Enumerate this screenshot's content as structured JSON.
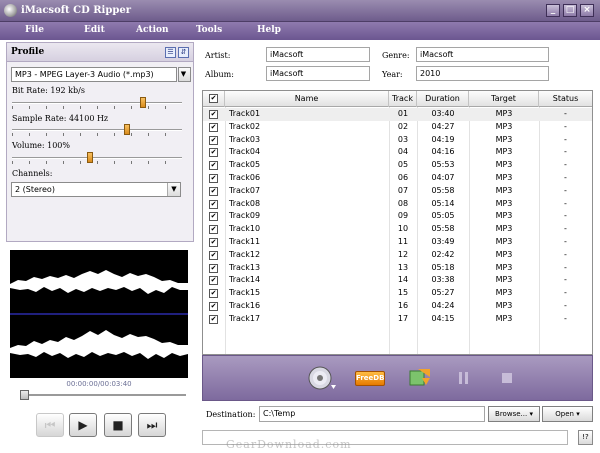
{
  "window": {
    "title": "iMacsoft CD Ripper",
    "minimize": "_",
    "maximize": "□",
    "close": "×"
  },
  "menu": [
    "File",
    "Edit",
    "Action",
    "Tools",
    "Help"
  ],
  "profile": {
    "title": "Profile",
    "format": "MP3 - MPEG Layer-3 Audio (*.mp3)",
    "bitrate_label": "Bit Rate: 192 kb/s",
    "samplerate_label": "Sample Rate: 44100 Hz",
    "volume_label": "Volume: 100%",
    "channels_label": "Channels:",
    "channels_value": "2 (Stereo)",
    "bitrate_level": 0.78,
    "samplerate_level": 0.68,
    "volume_level": 0.46
  },
  "player": {
    "time": "00:00:00/00:03:40",
    "seek_position": 0.0
  },
  "info": {
    "artist_label": "Artist:",
    "artist": "iMacsoft",
    "album_label": "Album:",
    "album": "iMacsoft",
    "genre_label": "Genre:",
    "genre": "iMacsoft",
    "year_label": "Year:",
    "year": "2010"
  },
  "columns": {
    "name": "Name",
    "track": "Track",
    "duration": "Duration",
    "target": "Target",
    "status": "Status"
  },
  "tracks": [
    {
      "name": "Track01",
      "track": "01",
      "duration": "03:40",
      "target": "MP3",
      "status": "-"
    },
    {
      "name": "Track02",
      "track": "02",
      "duration": "04:27",
      "target": "MP3",
      "status": "-"
    },
    {
      "name": "Track03",
      "track": "03",
      "duration": "04:19",
      "target": "MP3",
      "status": "-"
    },
    {
      "name": "Track04",
      "track": "04",
      "duration": "04:16",
      "target": "MP3",
      "status": "-"
    },
    {
      "name": "Track05",
      "track": "05",
      "duration": "05:53",
      "target": "MP3",
      "status": "-"
    },
    {
      "name": "Track06",
      "track": "06",
      "duration": "04:07",
      "target": "MP3",
      "status": "-"
    },
    {
      "name": "Track07",
      "track": "07",
      "duration": "05:58",
      "target": "MP3",
      "status": "-"
    },
    {
      "name": "Track08",
      "track": "08",
      "duration": "05:14",
      "target": "MP3",
      "status": "-"
    },
    {
      "name": "Track09",
      "track": "09",
      "duration": "05:05",
      "target": "MP3",
      "status": "-"
    },
    {
      "name": "Track10",
      "track": "10",
      "duration": "05:58",
      "target": "MP3",
      "status": "-"
    },
    {
      "name": "Track11",
      "track": "11",
      "duration": "03:49",
      "target": "MP3",
      "status": "-"
    },
    {
      "name": "Track12",
      "track": "12",
      "duration": "02:42",
      "target": "MP3",
      "status": "-"
    },
    {
      "name": "Track13",
      "track": "13",
      "duration": "05:18",
      "target": "MP3",
      "status": "-"
    },
    {
      "name": "Track14",
      "track": "14",
      "duration": "03:38",
      "target": "MP3",
      "status": "-"
    },
    {
      "name": "Track15",
      "track": "15",
      "duration": "05:27",
      "target": "MP3",
      "status": "-"
    },
    {
      "name": "Track16",
      "track": "16",
      "duration": "04:24",
      "target": "MP3",
      "status": "-"
    },
    {
      "name": "Track17",
      "track": "17",
      "duration": "04:15",
      "target": "MP3",
      "status": "-"
    }
  ],
  "actions": {
    "freedb": "FreeDB"
  },
  "destination": {
    "label": "Destination:",
    "path": "C:\\Temp",
    "browse": "Browse...",
    "open": "Open"
  },
  "status": {
    "help": "!?"
  },
  "watermark": "GearDownload.com",
  "colors": {
    "accent": "#7e6a9e",
    "titlebar": "#6e5c8c",
    "thumb": "#e0962a",
    "wave": "#ffffff",
    "divider": "#2a2aa8"
  }
}
